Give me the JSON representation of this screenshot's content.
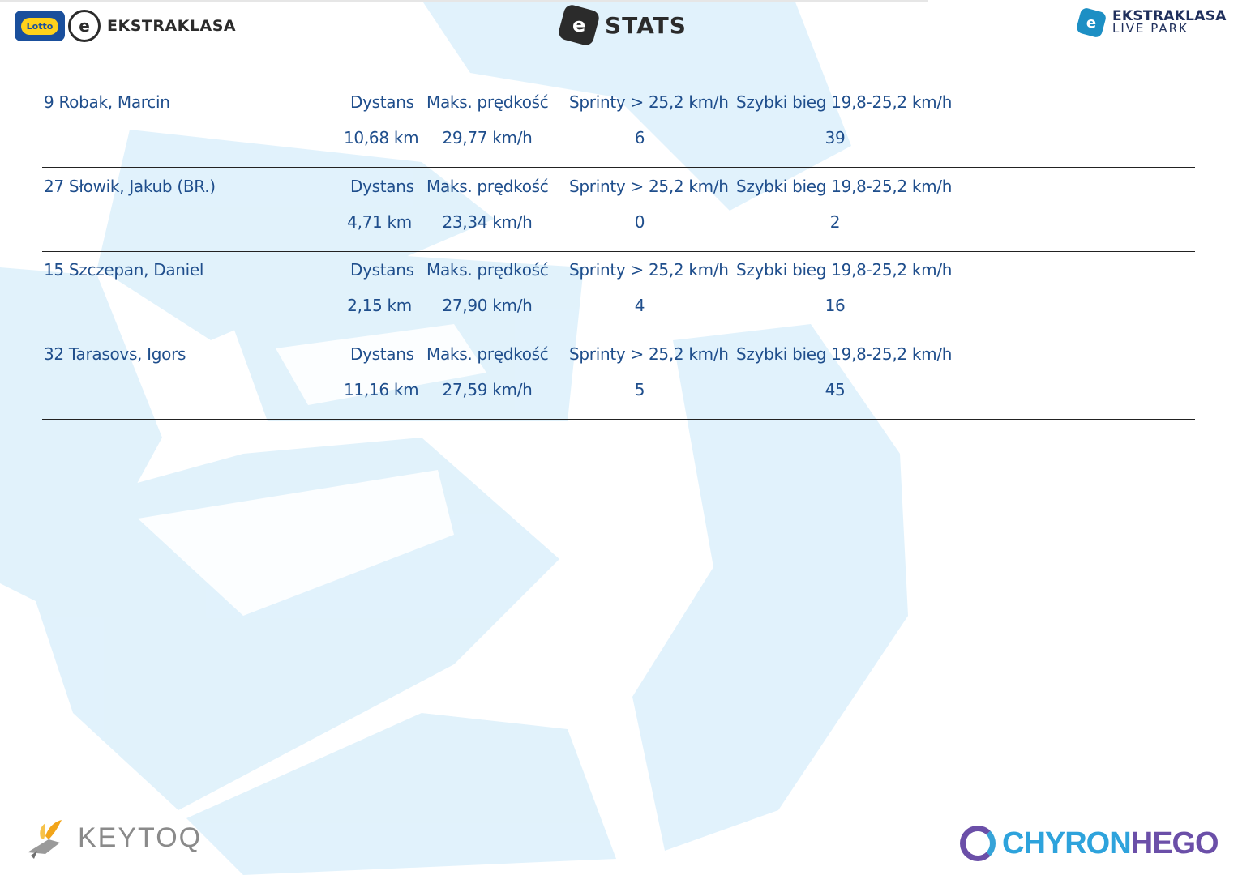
{
  "header": {
    "lotto_text": "Lotto",
    "league_text": "EKSTRAKLASA",
    "stats_text": "STATS",
    "live_park_line1": "EKSTRAKLASA",
    "live_park_line2": "LIVE PARK"
  },
  "labels": {
    "distance": "Dystans",
    "max_speed": "Maks. prędkość",
    "sprints": "Sprinty > 25,2 km/h",
    "fast_run": "Szybki bieg 19,8-25,2 km/h"
  },
  "players": [
    {
      "name": "9  Robak, Marcin",
      "distance": "10,68 km",
      "max_speed": "29,77 km/h",
      "sprints": "6",
      "fast_run": "39"
    },
    {
      "name": "27  Słowik, Jakub (BR.)",
      "distance": "4,71 km",
      "max_speed": "23,34 km/h",
      "sprints": "0",
      "fast_run": "2"
    },
    {
      "name": "15  Szczepan, Daniel",
      "distance": "2,15 km",
      "max_speed": "27,90 km/h",
      "sprints": "4",
      "fast_run": "16"
    },
    {
      "name": "32  Tarasovs, Igors",
      "distance": "11,16 km",
      "max_speed": "27,59 km/h",
      "sprints": "5",
      "fast_run": "45"
    }
  ],
  "footer": {
    "keytoq": "KEYTOQ",
    "chyron_part1": "CHYRON",
    "chyron_part2": "HEGO"
  },
  "colors": {
    "text_blue": "#1f4e8c",
    "watermark": "#dff0fa"
  },
  "icons": {
    "lotto": "lotto-logo-icon",
    "ekstraklasa_ball": "ekstraklasa-ball-icon",
    "stats_e": "e-stats-icon",
    "live_park_e": "e-live-park-icon",
    "keytoq": "keytoq-bird-icon",
    "chyron": "chyronhego-ring-icon"
  }
}
